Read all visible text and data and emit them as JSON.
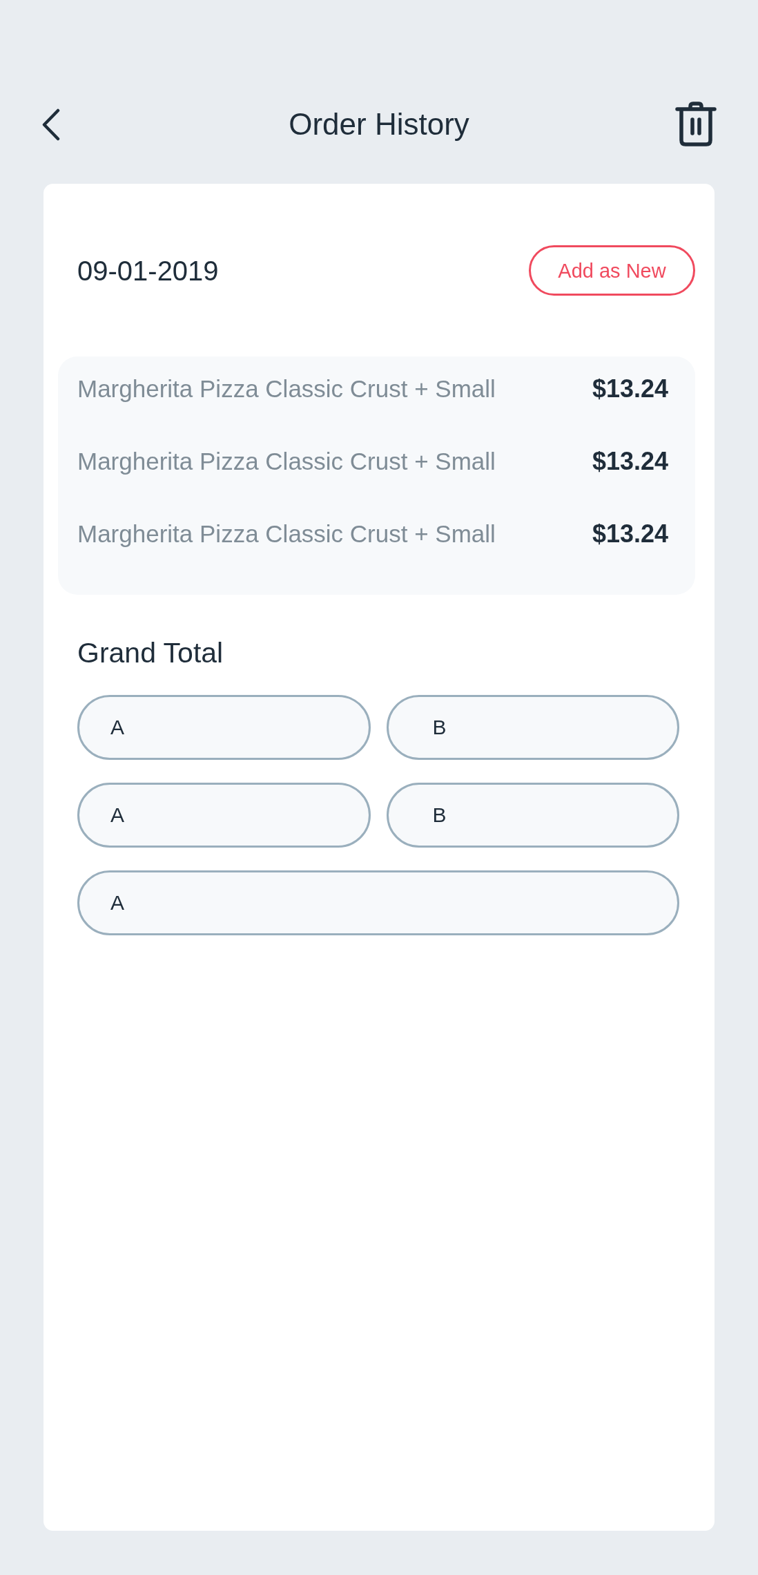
{
  "header": {
    "title": "Order History"
  },
  "order": {
    "date": "09-01-2019",
    "add_button": "Add as New",
    "items": [
      {
        "name": "Margherita Pizza Classic Crust + Small",
        "price": "$13.24"
      },
      {
        "name": "Margherita Pizza Classic Crust + Small",
        "price": "$13.24"
      },
      {
        "name": "Margherita Pizza Classic Crust + Small",
        "price": "$13.24"
      }
    ],
    "grand_total_label": "Grand Total",
    "fields": [
      {
        "value": "A",
        "kind": "half"
      },
      {
        "value": "B",
        "kind": "half"
      },
      {
        "value": "A",
        "kind": "half"
      },
      {
        "value": "B",
        "kind": "half"
      },
      {
        "value": "A",
        "kind": "full"
      }
    ]
  }
}
